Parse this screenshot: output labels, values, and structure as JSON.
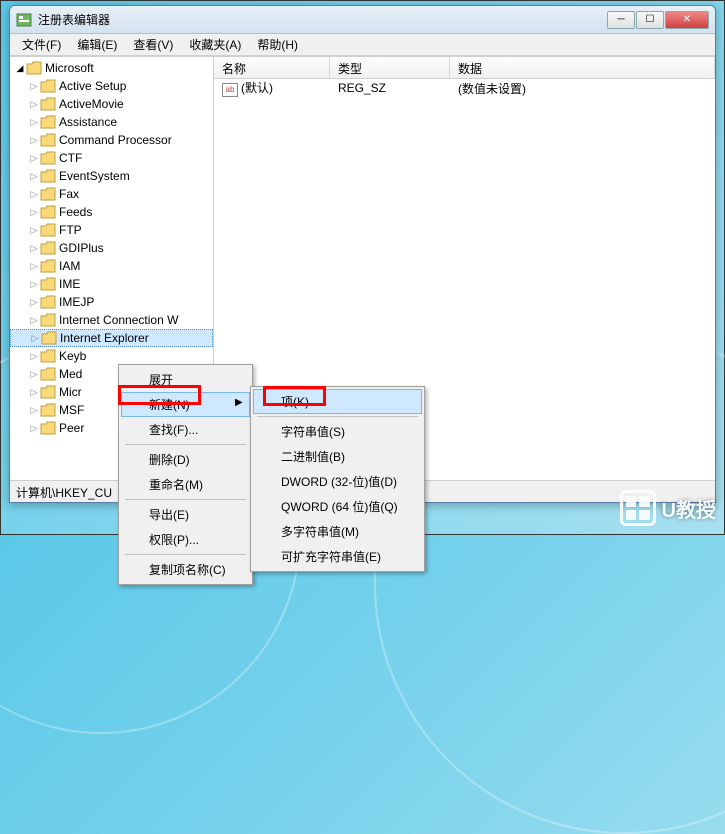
{
  "window": {
    "title": "注册表编辑器"
  },
  "menubar": {
    "file": "文件(F)",
    "edit": "编辑(E)",
    "view": "查看(V)",
    "favorites": "收藏夹(A)",
    "help": "帮助(H)"
  },
  "tree": {
    "root": "Microsoft",
    "items": [
      "Active Setup",
      "ActiveMovie",
      "Assistance",
      "Command Processor",
      "CTF",
      "EventSystem",
      "Fax",
      "Feeds",
      "FTP",
      "GDIPlus",
      "IAM",
      "IME",
      "IMEJP",
      "Internet Connection W",
      "Internet Explorer",
      "Keyb",
      "Med",
      "Micr",
      "MSF",
      "Peer"
    ]
  },
  "list": {
    "headers": {
      "name": "名称",
      "type": "类型",
      "data": "数据"
    },
    "row": {
      "name": "(默认)",
      "type": "REG_SZ",
      "data": "(数值未设置)"
    }
  },
  "statusbar": {
    "path": "计算机\\HKEY_CU"
  },
  "context_menu_1": {
    "expand": "展开",
    "new": "新建(N)",
    "find": "查找(F)...",
    "delete": "删除(D)",
    "rename": "重命名(M)",
    "export": "导出(E)",
    "permissions": "权限(P)...",
    "copy_key": "复制项名称(C)"
  },
  "context_menu_2": {
    "key": "项(K)",
    "string": "字符串值(S)",
    "binary": "二进制值(B)",
    "dword": "DWORD (32-位)值(D)",
    "qword": "QWORD (64 位)值(Q)",
    "multi_string": "多字符串值(M)",
    "expandable": "可扩充字符串值(E)"
  },
  "watermark": {
    "text": "U教授"
  }
}
